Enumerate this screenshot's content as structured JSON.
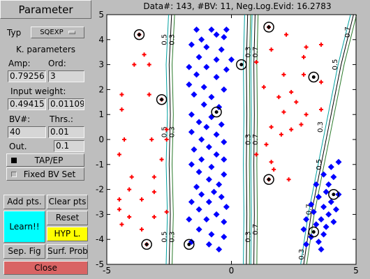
{
  "panel": {
    "title": "Parameter",
    "typ_label": "Typ",
    "typ_value": "SQEXP",
    "kparams_label": "K. parameters",
    "amp_label": "Amp:",
    "ord_label": "Ord:",
    "amp_value": "0.79256",
    "ord_value": "3",
    "input_weight_label": "Input weight:",
    "iw1_value": "0.49415",
    "iw2_value": "0.01109",
    "bv_label": "BV#:",
    "thrs_label": "Thrs.:",
    "bv_value": "40",
    "thrs_value": "0.01",
    "out_label": "Out.",
    "out_value": "0.1",
    "tap_ep_label": "TAP/EP",
    "fixed_bv_label": "Fixed BV Set",
    "add_pts_label": "Add pts.",
    "clear_pts_label": "Clear pts",
    "reset_label": "Reset",
    "learn_label": "Learn!!",
    "hyp_label": "HYP L.",
    "sep_fig_label": "Sep. Fig",
    "surf_prob_label": "Surf. Prob",
    "close_label": "Close",
    "colors": {
      "learn_bg": "#00ffff",
      "hyp_bg": "#ffff00",
      "close_bg": "#d96464"
    }
  },
  "plot": {
    "title": "Data#: 143, #BV: 11, Neg.Log.Evid: 16.2783"
  },
  "chart_data": {
    "type": "scatter",
    "xlim": [
      -5,
      5
    ],
    "ylim": [
      -5,
      5
    ],
    "x_ticks": [
      -5,
      0,
      5
    ],
    "y_ticks": [
      -5,
      -4,
      -3,
      -2,
      -1,
      0,
      1,
      2,
      3,
      4,
      5
    ],
    "x_tick_labels": [
      "-5",
      "0",
      "5"
    ],
    "y_tick_labels": [
      "-5",
      "-4",
      "-3",
      "-2",
      "-1",
      "0",
      "1",
      "2",
      "3",
      "4",
      "5"
    ],
    "grid": false,
    "series": [
      {
        "marker": "plus",
        "color": "#ff0000",
        "points": [
          [
            -3.7,
            4.2
          ],
          [
            -3.5,
            3.4
          ],
          [
            -3.9,
            3.0
          ],
          [
            -3.3,
            3.0
          ],
          [
            -4.4,
            1.8
          ],
          [
            -3.3,
            1.8
          ],
          [
            -2.8,
            1.6
          ],
          [
            -4.4,
            1.2
          ],
          [
            -2.6,
            0.4
          ],
          [
            -2.6,
            0.0
          ],
          [
            -4.3,
            0.0
          ],
          [
            -3.2,
            0.0
          ],
          [
            -4.5,
            -0.6
          ],
          [
            -2.8,
            -0.8
          ],
          [
            -4.0,
            -1.5
          ],
          [
            -3.1,
            -1.5
          ],
          [
            -4.1,
            -2.0
          ],
          [
            -3.1,
            -2.1
          ],
          [
            -4.5,
            -2.4
          ],
          [
            -3.6,
            -2.4
          ],
          [
            -4.5,
            -2.8
          ],
          [
            -4.1,
            -3.1
          ],
          [
            -3.1,
            -3.1
          ],
          [
            -2.6,
            -2.9
          ],
          [
            -4.4,
            -3.4
          ],
          [
            -3.6,
            -3.6
          ],
          [
            -3.4,
            -4.2
          ],
          [
            1.5,
            4.5
          ],
          [
            2.2,
            4.2
          ],
          [
            1.6,
            3.6
          ],
          [
            3.0,
            3.7
          ],
          [
            3.6,
            3.8
          ],
          [
            2.9,
            3.3
          ],
          [
            1.0,
            3.1
          ],
          [
            2.1,
            2.6
          ],
          [
            2.9,
            2.6
          ],
          [
            3.6,
            2.3
          ],
          [
            1.3,
            2.1
          ],
          [
            2.4,
            1.9
          ],
          [
            1.9,
            1.7
          ],
          [
            2.6,
            1.5
          ],
          [
            3.6,
            1.2
          ],
          [
            2.1,
            1.1
          ],
          [
            3.0,
            1.0
          ],
          [
            2.8,
            0.6
          ],
          [
            1.6,
            0.5
          ],
          [
            2.4,
            0.4
          ],
          [
            2.0,
            0.2
          ],
          [
            1.4,
            -0.2
          ],
          [
            1.0,
            -0.6
          ],
          [
            1.6,
            -0.9
          ],
          [
            1.7,
            -1.2
          ],
          [
            1.5,
            -1.6
          ],
          [
            2.3,
            -1.6
          ]
        ]
      },
      {
        "marker": "diamond",
        "color": "#0000ff",
        "points": [
          [
            -1.4,
            4.4
          ],
          [
            -0.8,
            4.4
          ],
          [
            -0.2,
            4.4
          ],
          [
            -0.6,
            4.2
          ],
          [
            -1.2,
            4.0
          ],
          [
            -0.3,
            4.1
          ],
          [
            -1.6,
            3.8
          ],
          [
            -1.0,
            3.7
          ],
          [
            -0.4,
            3.6
          ],
          [
            -1.3,
            3.3
          ],
          [
            -0.6,
            3.2
          ],
          [
            0.0,
            3.2
          ],
          [
            -1.7,
            2.9
          ],
          [
            -1.0,
            2.9
          ],
          [
            -0.2,
            2.8
          ],
          [
            -1.4,
            2.6
          ],
          [
            -0.6,
            2.5
          ],
          [
            -1.7,
            2.2
          ],
          [
            -1.1,
            2.1
          ],
          [
            -0.3,
            2.0
          ],
          [
            -1.5,
            1.8
          ],
          [
            -0.8,
            1.7
          ],
          [
            -1.1,
            1.4
          ],
          [
            -0.5,
            1.3
          ],
          [
            -1.6,
            1.0
          ],
          [
            -0.8,
            0.9
          ],
          [
            -1.3,
            0.7
          ],
          [
            -0.4,
            0.6
          ],
          [
            -1.0,
            0.5
          ],
          [
            -1.6,
            0.3
          ],
          [
            -0.6,
            0.2
          ],
          [
            -1.2,
            0.0
          ],
          [
            -0.3,
            -0.1
          ],
          [
            -0.9,
            -0.3
          ],
          [
            -1.5,
            -0.4
          ],
          [
            -0.6,
            -0.6
          ],
          [
            -1.2,
            -0.8
          ],
          [
            -0.3,
            -0.8
          ],
          [
            -1.6,
            -1.0
          ],
          [
            -0.8,
            -1.1
          ],
          [
            -0.3,
            -1.4
          ],
          [
            -1.3,
            -1.3
          ],
          [
            -0.9,
            -1.6
          ],
          [
            -0.5,
            -1.8
          ],
          [
            -1.4,
            -1.9
          ],
          [
            -0.7,
            -2.1
          ],
          [
            -1.2,
            -2.2
          ],
          [
            -0.4,
            -2.3
          ],
          [
            -1.6,
            -2.5
          ],
          [
            -0.9,
            -2.5
          ],
          [
            -0.2,
            -2.7
          ],
          [
            -1.3,
            -2.8
          ],
          [
            -0.6,
            -3.0
          ],
          [
            -1.0,
            -3.2
          ],
          [
            -1.7,
            -3.2
          ],
          [
            -0.3,
            -3.3
          ],
          [
            -1.3,
            -3.6
          ],
          [
            -0.8,
            -3.8
          ],
          [
            -0.3,
            -3.9
          ],
          [
            -1.6,
            -4.1
          ],
          [
            -0.9,
            -4.2
          ],
          [
            -0.5,
            -4.4
          ],
          [
            4.3,
            -0.9
          ],
          [
            4.0,
            -1.1
          ],
          [
            4.1,
            -1.5
          ],
          [
            3.7,
            -1.4
          ],
          [
            3.9,
            -1.8
          ],
          [
            3.4,
            -1.8
          ],
          [
            3.8,
            -2.1
          ],
          [
            4.3,
            -2.2
          ],
          [
            3.5,
            -2.3
          ],
          [
            4.0,
            -2.5
          ],
          [
            3.2,
            -2.6
          ],
          [
            3.7,
            -2.7
          ],
          [
            4.2,
            -2.8
          ],
          [
            3.3,
            -2.9
          ],
          [
            3.9,
            -3.0
          ],
          [
            3.6,
            -3.2
          ],
          [
            4.1,
            -3.3
          ],
          [
            3.0,
            -3.2
          ],
          [
            3.4,
            -3.4
          ],
          [
            3.8,
            -3.5
          ],
          [
            2.9,
            -3.6
          ],
          [
            3.7,
            -3.8
          ],
          [
            3.2,
            -3.9
          ],
          [
            3.5,
            -4.1
          ],
          [
            3.0,
            -4.2
          ],
          [
            3.6,
            -4.4
          ]
        ]
      }
    ],
    "basis_vectors": [
      [
        -3.7,
        4.2
      ],
      [
        -2.8,
        1.6
      ],
      [
        -3.4,
        -4.2
      ],
      [
        1.5,
        4.5
      ],
      [
        3.3,
        2.5
      ],
      [
        1.5,
        -1.6
      ],
      [
        0.4,
        3.0
      ],
      [
        -0.6,
        1.1
      ],
      [
        -1.7,
        -4.2
      ],
      [
        3.3,
        -3.7
      ],
      [
        4.1,
        -2.2
      ]
    ],
    "contours": [
      {
        "label": "0.3",
        "offset": -0.12
      },
      {
        "label": "0.5",
        "offset": 0.0
      },
      {
        "label": "0.7",
        "offset": 0.12
      }
    ],
    "boundaries": [
      {
        "points": [
          [
            -2.4,
            5
          ],
          [
            -2.5,
            3
          ],
          [
            -2.45,
            1
          ],
          [
            -2.5,
            -1
          ],
          [
            -2.45,
            -3
          ],
          [
            -2.5,
            -5
          ]
        ]
      },
      {
        "points": [
          [
            0.65,
            5
          ],
          [
            0.6,
            3
          ],
          [
            0.62,
            1
          ],
          [
            0.6,
            -1
          ],
          [
            0.62,
            -3
          ],
          [
            0.6,
            -5
          ]
        ]
      },
      {
        "points": [
          [
            0.95,
            5
          ],
          [
            0.9,
            3
          ],
          [
            0.92,
            1
          ],
          [
            0.9,
            -1
          ],
          [
            0.92,
            -3
          ],
          [
            0.9,
            -5
          ]
        ]
      },
      {
        "points": [
          [
            4.9,
            5
          ],
          [
            4.4,
            3
          ],
          [
            4.0,
            1
          ],
          [
            3.6,
            -1
          ],
          [
            3.2,
            -3
          ],
          [
            2.9,
            -5
          ]
        ]
      }
    ],
    "contour_labels": [
      {
        "text": "0.3",
        "at": [
          -2.3,
          4.0
        ]
      },
      {
        "text": "0.5",
        "at": [
          -2.6,
          4.0
        ]
      },
      {
        "text": "0.3",
        "at": [
          -2.3,
          0.3
        ]
      },
      {
        "text": "0.5",
        "at": [
          -2.6,
          0.3
        ]
      },
      {
        "text": "0.3",
        "at": [
          -2.3,
          -3.9
        ]
      },
      {
        "text": "0.5",
        "at": [
          -2.6,
          -3.9
        ]
      },
      {
        "text": "0.3",
        "at": [
          0.75,
          3.5
        ]
      },
      {
        "text": "0.7",
        "at": [
          1.05,
          3.5
        ]
      },
      {
        "text": "0.3",
        "at": [
          0.75,
          0.0
        ]
      },
      {
        "text": "0.7",
        "at": [
          1.05,
          0.0
        ]
      },
      {
        "text": "0.3",
        "at": [
          0.75,
          -3.9
        ]
      },
      {
        "text": "0.7",
        "at": [
          1.05,
          -3.6
        ]
      },
      {
        "text": "0.7",
        "at": [
          4.75,
          4.3
        ]
      },
      {
        "text": "0.5",
        "at": [
          4.25,
          3.0
        ]
      },
      {
        "text": "0.3",
        "at": [
          3.65,
          0.5
        ]
      },
      {
        "text": "0.5",
        "at": [
          3.6,
          -1.0
        ]
      },
      {
        "text": "0.7",
        "at": [
          3.2,
          -2.8
        ]
      },
      {
        "text": "0.3",
        "at": [
          2.9,
          -4.6
        ]
      }
    ]
  }
}
